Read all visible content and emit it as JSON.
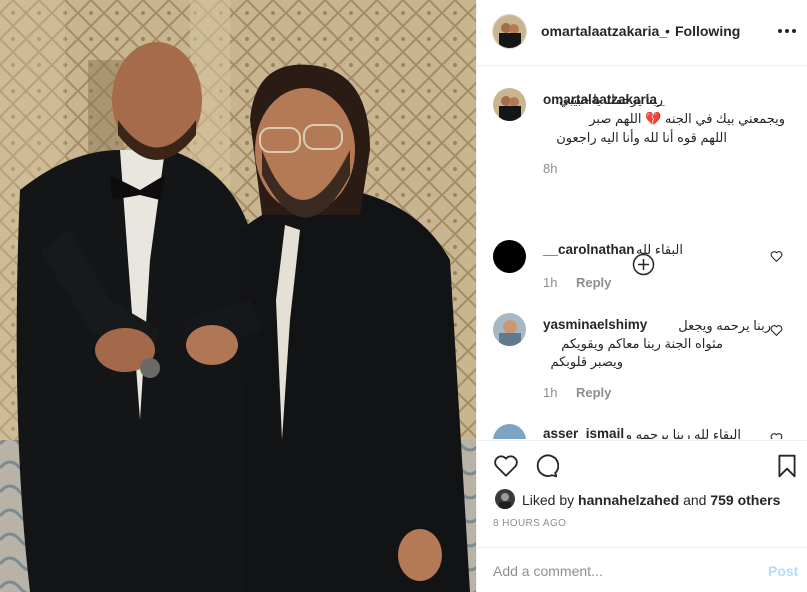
{
  "post": {
    "username": "omartalaatzakaria_",
    "separator": "•",
    "follow_status": "Following",
    "caption": {
      "username": "omartalaatzakaria_",
      "line1": "ربنا يرحمك يا حبيبي",
      "line2": "ويجمعني بيك في الجنه 💔 اللهم صبر",
      "line3": "اللهم قوه أنا لله وأنا اليه راجعون",
      "time": "8h"
    },
    "comments": [
      {
        "username": "__carolnathan",
        "text": "البقاء لله",
        "time": "1h",
        "reply_label": "Reply"
      },
      {
        "username": "yasminaelshimy",
        "line1": "ربنا يرحمه ويجعل",
        "line2": "مثواه الجنة ربنا معاكم ويقويكم",
        "line3": "ويصبر قلوبكم",
        "time": "1h",
        "reply_label": "Reply"
      },
      {
        "username": "asser_ismail",
        "text": "البقاء لله ربنا يرحمه و"
      }
    ],
    "liked_by": {
      "prefix": "Liked by",
      "user": "hannahelzahed",
      "conj": "and",
      "others": "759 others"
    },
    "time_ago": "8 HOURS AGO",
    "add_comment_placeholder": "Add a comment...",
    "post_label": "Post"
  },
  "icons": {
    "more": "more-options-icon",
    "load_more": "plus-circle-icon",
    "like": "heart-icon",
    "comment": "comment-bubble-icon",
    "save": "bookmark-icon"
  },
  "colors": {
    "text": "#262626",
    "muted": "#8e8e8e",
    "border": "#efefef",
    "post_disabled": "#b3dbff"
  }
}
